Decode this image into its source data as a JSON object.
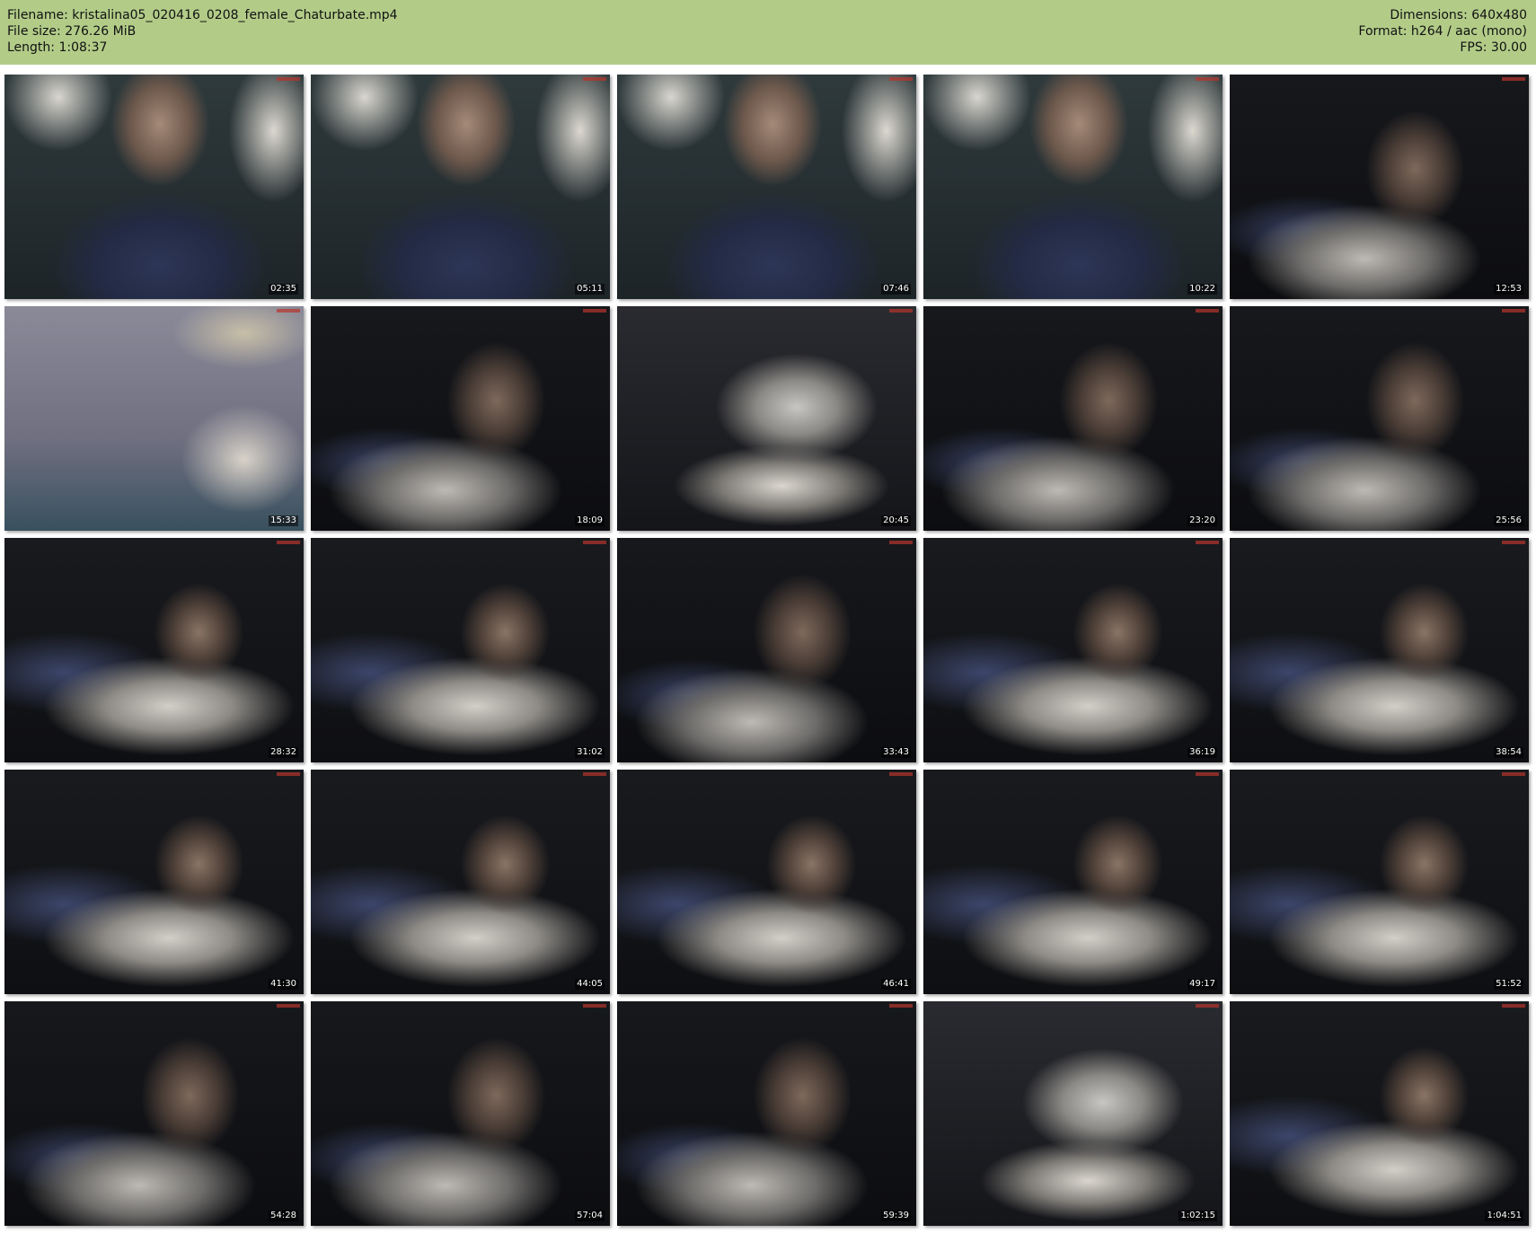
{
  "header": {
    "filename_line": "Filename: kristalina05_020416_0208_female_Chaturbate.mp4",
    "filesize_line": "File size: 276.26 MiB",
    "length_line": "Length: 1:08:37",
    "dimensions_line": "Dimensions: 640x480",
    "format_line": "Format: h264 / aac (mono)",
    "fps_line": "FPS: 30.00",
    "background_color": "#b2cc88"
  },
  "thumbnails": [
    {
      "time": "02:35"
    },
    {
      "time": "05:11"
    },
    {
      "time": "07:46"
    },
    {
      "time": "10:22"
    },
    {
      "time": "12:53"
    },
    {
      "time": "15:33"
    },
    {
      "time": "18:09"
    },
    {
      "time": "20:45"
    },
    {
      "time": "23:20"
    },
    {
      "time": "25:56"
    },
    {
      "time": "28:32"
    },
    {
      "time": "31:02"
    },
    {
      "time": "33:43"
    },
    {
      "time": "36:19"
    },
    {
      "time": "38:54"
    },
    {
      "time": "41:30"
    },
    {
      "time": "44:05"
    },
    {
      "time": "46:41"
    },
    {
      "time": "49:17"
    },
    {
      "time": "51:52"
    },
    {
      "time": "54:28"
    },
    {
      "time": "57:04"
    },
    {
      "time": "59:39"
    },
    {
      "time": "1:02:15"
    },
    {
      "time": "1:04:51"
    }
  ]
}
